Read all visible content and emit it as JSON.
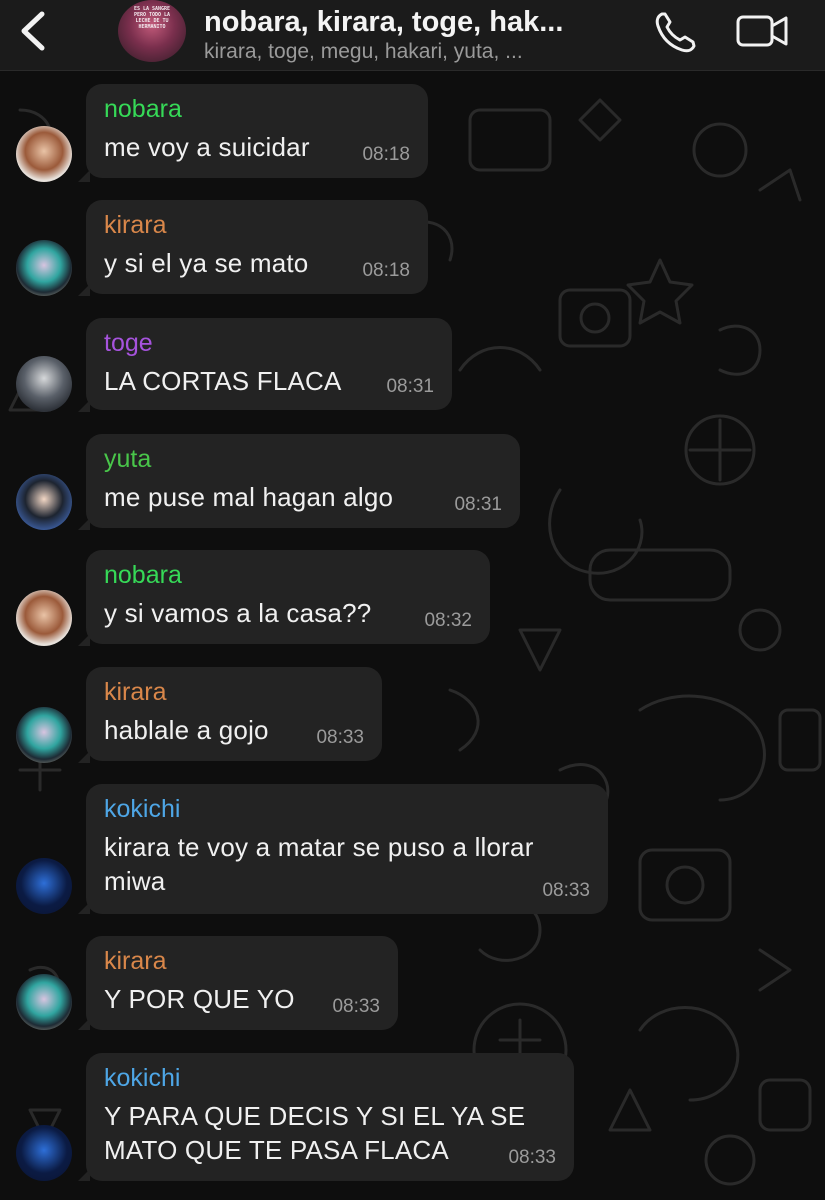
{
  "header": {
    "back_icon": "chevron-left-icon",
    "group_avatar_shirt_text": "ES LA SANGRE PERO TODO LA LECHE DE TU HERMANITO",
    "title": "nobara, kirara, toge, hak...",
    "subtitle": "kirara, toge, megu, hakari, yuta, ...",
    "call_icon": "phone-icon",
    "video_icon": "video-camera-icon"
  },
  "colors": {
    "nobara": "#36d957",
    "kirara": "#d9874a",
    "toge": "#a653dd",
    "yuta": "#49c64a",
    "kokichi": "#4ea6e6",
    "bubble": "#232323",
    "header_bg": "#1b1b1b"
  },
  "messages": [
    {
      "sender": "nobara",
      "text": "me voy a suicidar",
      "time": "08:18"
    },
    {
      "sender": "kirara",
      "text": "y si el ya se mato",
      "time": "08:18"
    },
    {
      "sender": "toge",
      "text": "LA CORTAS FLACA",
      "time": "08:31"
    },
    {
      "sender": "yuta",
      "text": "me puse mal hagan algo",
      "time": "08:31"
    },
    {
      "sender": "nobara",
      "text": "y si vamos a la casa??",
      "time": "08:32"
    },
    {
      "sender": "kirara",
      "text": "hablale a gojo",
      "time": "08:33"
    },
    {
      "sender": "kokichi",
      "text": "kirara te voy a matar se puso a llorar miwa",
      "time": "08:33"
    },
    {
      "sender": "kirara",
      "text": "Y POR QUE YO",
      "time": "08:33"
    },
    {
      "sender": "kokichi",
      "text": "Y PARA QUE DECIS Y SI EL YA SE MATO QUE TE PASA FLACA",
      "time": "08:33"
    }
  ]
}
